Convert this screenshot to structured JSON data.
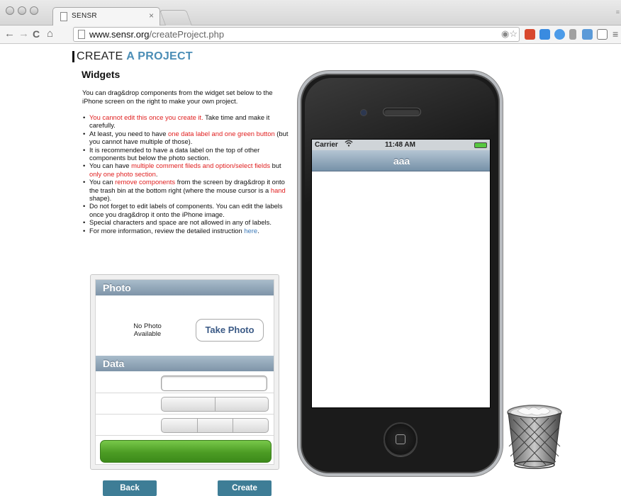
{
  "browser": {
    "tab_title": "SENSR",
    "tab_close": "×",
    "url_domain": "www.sensr.org",
    "url_path": "/createProject.php",
    "nav": {
      "back": "←",
      "forward": "→",
      "reload": "C",
      "home": "⌂"
    }
  },
  "page": {
    "title_prefix": "CREATE",
    "title_accent": "A PROJECT",
    "heading": "Widgets",
    "intro": "You can drag&drop components from the widget set below to the iPhone screen on the right to make your own project.",
    "rules": [
      {
        "parts": [
          {
            "text": "You cannot edit this once you create it.",
            "red": true
          },
          {
            "text": " Take time and make it carefully.",
            "red": false
          }
        ]
      },
      {
        "parts": [
          {
            "text": "At least, you need to have ",
            "red": false
          },
          {
            "text": "one data label and one green button",
            "red": true
          },
          {
            "text": " (but you cannot have multiple of those).",
            "red": false
          }
        ]
      },
      {
        "parts": [
          {
            "text": "It is recommended to have a data label on the top of other components but below the photo section.",
            "red": false
          }
        ]
      },
      {
        "parts": [
          {
            "text": "You can have ",
            "red": false
          },
          {
            "text": "multiple comment fileds and option/select fields",
            "red": true
          },
          {
            "text": " but ",
            "red": false
          },
          {
            "text": "only one photo section",
            "red": true
          },
          {
            "text": ".",
            "red": false
          }
        ]
      },
      {
        "parts": [
          {
            "text": "You can ",
            "red": false
          },
          {
            "text": "remove components",
            "red": true
          },
          {
            "text": " from the screen by drag&drop it onto the trash bin at the bottom right (where the mouse cursor is a ",
            "red": false
          },
          {
            "text": "hand",
            "red": true
          },
          {
            "text": " shape).",
            "red": false
          }
        ]
      },
      {
        "parts": [
          {
            "text": "Do not forget to edit labels of components. You can edit the labels once you drag&drop it onto the iPhone image.",
            "red": false
          }
        ]
      },
      {
        "parts": [
          {
            "text": "Special characters and space are not allowed in any of labels.",
            "red": false
          }
        ]
      },
      {
        "parts": [
          {
            "text": "For more information, review the detailed instruction ",
            "red": false
          },
          {
            "text": "here",
            "link": true
          },
          {
            "text": ".",
            "red": false
          }
        ]
      }
    ]
  },
  "widgets": {
    "photo_header": "Photo",
    "no_photo": "No Photo Available",
    "take_photo": "Take Photo",
    "data_header": "Data",
    "input_value": ""
  },
  "actions": {
    "back": "Back",
    "create": "Create"
  },
  "iphone": {
    "carrier": "Carrier",
    "time": "11:48 AM",
    "nav_title": "aaa"
  },
  "colors": {
    "accent": "#4a8db6",
    "warning_text": "#e02020",
    "link": "#3a78b8",
    "green_button": "#4c9c24",
    "action_button": "#3e7d96"
  },
  "icons": [
    "page-icon",
    "star-icon",
    "wifi-icon",
    "battery-icon",
    "home-button-icon",
    "trash-bin-icon"
  ]
}
